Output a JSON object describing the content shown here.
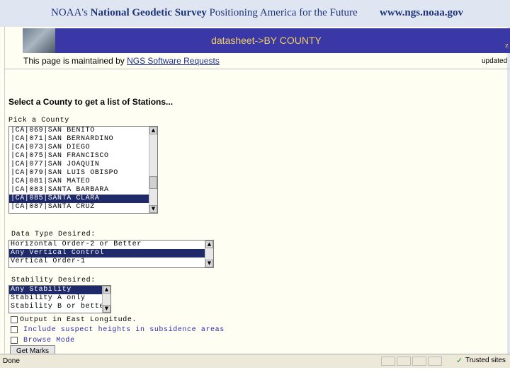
{
  "header": {
    "brand_prefix": "NOAA's ",
    "brand_name": "National Geodetic Survey",
    "brand_tagline": " Positioning America for the Future",
    "site": "www.ngs.noaa.gov"
  },
  "banner": {
    "title": "datasheet->BY COUNTY",
    "corner_glyph": "z"
  },
  "maintenance": {
    "prefix": "This page is maintained by ",
    "link": "NGS Software Requests",
    "updated": "updated"
  },
  "heading": "Select a County to get a list of Stations...",
  "county": {
    "label": "Pick a County",
    "options": [
      "|CA|069|SAN BENITO",
      "|CA|071|SAN BERNARDINO",
      "|CA|073|SAN DIEGO",
      "|CA|075|SAN FRANCISCO",
      "|CA|077|SAN JOAQUIN",
      "|CA|079|SAN LUIS OBISPO",
      "|CA|081|SAN MATEO",
      "|CA|083|SANTA BARBARA",
      "|CA|085|SANTA CLARA",
      "|CA|087|SANTA CRUZ"
    ],
    "selected": "|CA|085|SANTA CLARA"
  },
  "data_type": {
    "label": "Data Type Desired:",
    "options": [
      "Horizontal Order-2 or Better",
      "Any Vertical Control",
      "Vertical Order-1"
    ],
    "selected": "Any Vertical Control"
  },
  "stability": {
    "label": "Stability Desired:",
    "options": [
      "Any Stability",
      "Stability A only",
      "Stability B or better"
    ],
    "selected": "Any Stability"
  },
  "options": {
    "east_longitude": "Output in East Longitude.",
    "suspect_heights": "Include suspect heights in subsidence areas",
    "browse_mode": "Browse Mode"
  },
  "submit": "Get Marks",
  "statusbar": {
    "status": "Done",
    "zone": "Trusted sites",
    "check_glyph": "✓"
  }
}
